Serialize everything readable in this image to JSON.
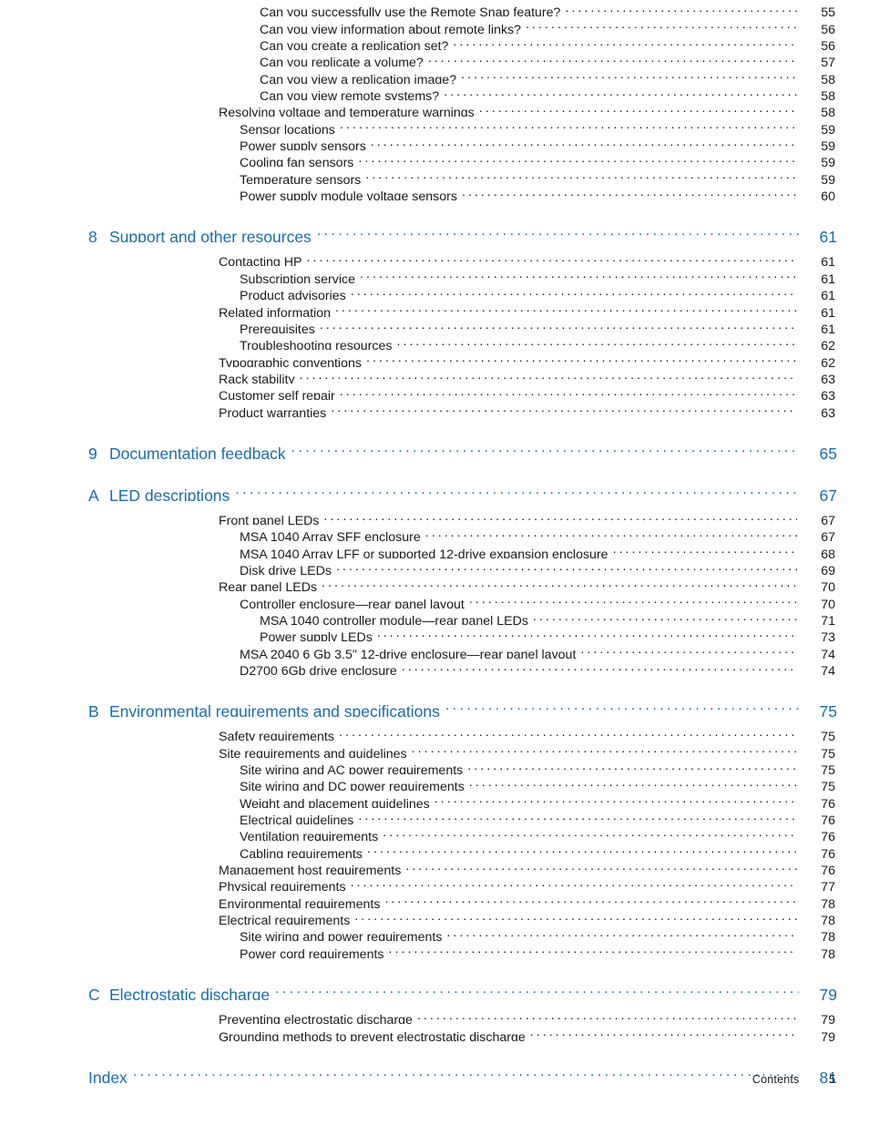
{
  "page": {
    "footer_label": "Contents",
    "footer_page": "5",
    "accent_color": "#1a6bb0",
    "text_color": "#1a1a1a"
  },
  "toc": {
    "groups": [
      {
        "id": "group-remote-snap",
        "entries": [
          {
            "level": 3,
            "title": "Can you successfully use the Remote Snap feature?",
            "page": "55"
          },
          {
            "level": 3,
            "title": "Can you view information about remote links?",
            "page": "56"
          },
          {
            "level": 3,
            "title": "Can you create a replication set?",
            "page": "56"
          },
          {
            "level": 3,
            "title": "Can you replicate a volume?",
            "page": "57"
          },
          {
            "level": 3,
            "title": "Can you view a replication image?",
            "page": "58"
          },
          {
            "level": 3,
            "title": "Can you view remote systems?",
            "page": "58"
          },
          {
            "level": 1,
            "title": "Resolving voltage and temperature warnings",
            "page": "58"
          },
          {
            "level": 2,
            "title": "Sensor locations",
            "page": "59"
          },
          {
            "level": 2,
            "title": "Power supply sensors",
            "page": "59"
          },
          {
            "level": 2,
            "title": "Cooling fan sensors",
            "page": "59"
          },
          {
            "level": 2,
            "title": "Temperature sensors",
            "page": "59"
          },
          {
            "level": 2,
            "title": "Power supply module voltage sensors",
            "page": "60"
          }
        ]
      },
      {
        "id": "group-chapter-8",
        "chapter": {
          "number": "8",
          "title": "Support and other resources",
          "page": "61"
        },
        "entries": [
          {
            "level": 1,
            "title": "Contacting HP",
            "page": "61"
          },
          {
            "level": 2,
            "title": "Subscription service",
            "page": "61"
          },
          {
            "level": 2,
            "title": "Product advisories",
            "page": "61"
          },
          {
            "level": 1,
            "title": "Related information",
            "page": "61"
          },
          {
            "level": 2,
            "title": "Prerequisites",
            "page": "61"
          },
          {
            "level": 2,
            "title": "Troubleshooting resources",
            "page": "62"
          },
          {
            "level": 1,
            "title": "Typographic conventions",
            "page": "62"
          },
          {
            "level": 1,
            "title": "Rack stability",
            "page": "63"
          },
          {
            "level": 1,
            "title": "Customer self repair",
            "page": "63"
          },
          {
            "level": 1,
            "title": "Product warranties",
            "page": "63"
          }
        ]
      },
      {
        "id": "group-chapter-9",
        "chapter": {
          "number": "9",
          "title": "Documentation feedback",
          "page": "65"
        },
        "entries": []
      },
      {
        "id": "group-appendix-a",
        "chapter": {
          "number": "A",
          "title": "LED descriptions",
          "page": "67"
        },
        "entries": [
          {
            "level": 1,
            "title": "Front panel LEDs",
            "page": "67"
          },
          {
            "level": 2,
            "title": "MSA 1040 Array SFF enclosure",
            "page": "67"
          },
          {
            "level": 2,
            "title": "MSA 1040 Array LFF or supported 12-drive expansion enclosure",
            "page": "68"
          },
          {
            "level": 2,
            "title": "Disk drive LEDs",
            "page": "69"
          },
          {
            "level": 1,
            "title": "Rear panel LEDs",
            "page": "70"
          },
          {
            "level": 2,
            "title": "Controller enclosure—rear panel layout",
            "page": "70"
          },
          {
            "level": 3,
            "title": "MSA 1040 controller module—rear panel LEDs",
            "page": "71"
          },
          {
            "level": 3,
            "title": "Power supply LEDs",
            "page": "73"
          },
          {
            "level": 2,
            "title": "MSA 2040 6 Gb 3.5\" 12-drive enclosure—rear panel layout",
            "page": "74"
          },
          {
            "level": 2,
            "title": "D2700 6Gb drive enclosure",
            "page": "74"
          }
        ]
      },
      {
        "id": "group-appendix-b",
        "chapter": {
          "number": "B",
          "title": "Environmental requirements and specifications",
          "page": "75"
        },
        "entries": [
          {
            "level": 1,
            "title": "Safety requirements",
            "page": "75"
          },
          {
            "level": 1,
            "title": "Site requirements and guidelines",
            "page": "75"
          },
          {
            "level": 2,
            "title": "Site wiring and AC power requirements",
            "page": "75"
          },
          {
            "level": 2,
            "title": "Site wiring and DC power requirements",
            "page": "75"
          },
          {
            "level": 2,
            "title": "Weight and placement guidelines",
            "page": "76"
          },
          {
            "level": 2,
            "title": "Electrical guidelines",
            "page": "76"
          },
          {
            "level": 2,
            "title": "Ventilation requirements",
            "page": "76"
          },
          {
            "level": 2,
            "title": "Cabling requirements",
            "page": "76"
          },
          {
            "level": 1,
            "title": "Management host requirements",
            "page": "76"
          },
          {
            "level": 1,
            "title": "Physical requirements",
            "page": "77"
          },
          {
            "level": 1,
            "title": "Environmental requirements",
            "page": "78"
          },
          {
            "level": 1,
            "title": "Electrical requirements",
            "page": "78"
          },
          {
            "level": 2,
            "title": "Site wiring and power requirements",
            "page": "78"
          },
          {
            "level": 2,
            "title": "Power cord requirements",
            "page": "78"
          }
        ]
      },
      {
        "id": "group-appendix-c",
        "chapter": {
          "number": "C",
          "title": "Electrostatic discharge",
          "page": "79"
        },
        "entries": [
          {
            "level": 1,
            "title": "Preventing electrostatic discharge",
            "page": "79"
          },
          {
            "level": 1,
            "title": "Grounding methods to prevent electrostatic discharge",
            "page": "79"
          }
        ]
      },
      {
        "id": "group-index",
        "chapter": {
          "number": "",
          "title": "Index",
          "page": "81"
        },
        "entries": []
      }
    ]
  }
}
